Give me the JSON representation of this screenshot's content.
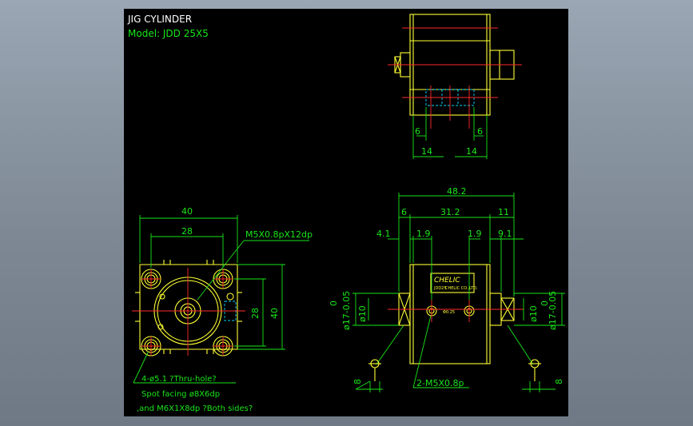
{
  "drawing": {
    "title_line1": "JIG CYLINDER",
    "title_line2": "Model: JDD 25X5",
    "brand_label": "CHELIC",
    "nameplate_small1": "JDD25",
    "nameplate_small2": "CHELIC CO.,LTD.",
    "port_mark": "Φ0.25",
    "colors": {
      "background": "#000000",
      "outline": "#ffff33",
      "dimension": "#19e619",
      "centerline": "#ff2a2a",
      "hidden": "#00d5ff",
      "text": "#ffffff"
    }
  },
  "dimensions": {
    "top_left_6": "6",
    "top_right_6": "6",
    "top_left_14": "14",
    "top_right_14": "14",
    "front_overall_width": "40",
    "front_inner_width": "28",
    "front_thread": "M5X0.8pX12dp",
    "front_inner_height": "28",
    "front_overall_height": "40",
    "side_overall": "48.2",
    "side_6": "6",
    "side_31_2": "31.2",
    "side_11": "11",
    "side_4_1": "4.1",
    "side_1_9_left": "1.9",
    "side_1_9_right": "1.9",
    "side_9_1": "9.1",
    "side_dia_17_left": "ø17-0.05",
    "side_dia_17_left_tol": "0",
    "side_dia_10_left": "ø10",
    "side_dia_10_right": "ø10",
    "side_dia_17_right": "ø17-0.05",
    "side_dia_17_right_tol": "0",
    "side_8_left": "8",
    "side_8_right": "8",
    "side_port_thread": "2-M5X0.8p"
  },
  "notes": {
    "line1": "4-ø5.1 ?Thru-hole?",
    "line2": "Spot facing  ø8X6dp",
    "line3": ",and  M6X1X8dp ?Both sides?"
  }
}
